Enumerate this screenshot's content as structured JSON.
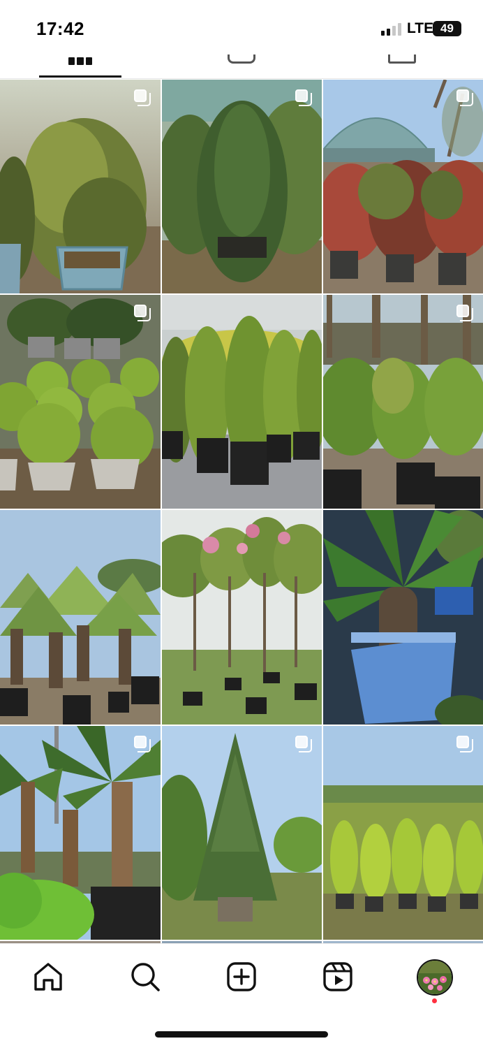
{
  "status_bar": {
    "time": "17:42",
    "network": "LTE",
    "battery_level": "49",
    "signal_bars_active": 2,
    "signal_bars_total": 4
  },
  "profile_tabs": [
    {
      "icon": "grid-icon",
      "selected": true
    },
    {
      "icon": "reels-tab-icon",
      "selected": false
    },
    {
      "icon": "tagged-tab-icon",
      "selected": false
    }
  ],
  "posts": [
    {
      "description_icon": "plant-photo",
      "multiple": true
    },
    {
      "description_icon": "plant-photo",
      "multiple": true
    },
    {
      "description_icon": "plant-photo",
      "multiple": true
    },
    {
      "description_icon": "plant-photo",
      "multiple": true
    },
    {
      "description_icon": "plant-photo",
      "multiple": false
    },
    {
      "description_icon": "plant-photo",
      "multiple": true
    },
    {
      "description_icon": "plant-photo",
      "multiple": false
    },
    {
      "description_icon": "plant-photo",
      "multiple": true
    },
    {
      "description_icon": "plant-photo",
      "multiple": false
    },
    {
      "description_icon": "plant-photo",
      "multiple": true
    },
    {
      "description_icon": "plant-photo",
      "multiple": true
    },
    {
      "description_icon": "plant-photo",
      "multiple": true
    }
  ],
  "bottom_nav": [
    {
      "icon": "home-icon"
    },
    {
      "icon": "search-icon"
    },
    {
      "icon": "create-post-icon"
    },
    {
      "icon": "reels-icon"
    },
    {
      "icon": "profile-avatar"
    }
  ],
  "colors": {
    "text": "#111111",
    "notification_dot": "#ff3040",
    "battery_fill": "#ffffff"
  }
}
